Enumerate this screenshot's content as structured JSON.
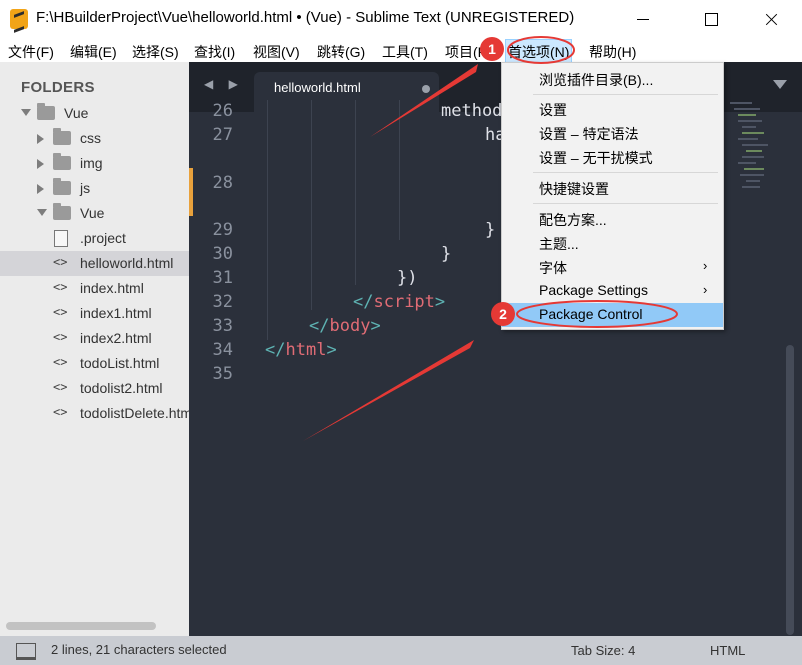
{
  "window": {
    "title": "F:\\HBuilderProject\\Vue\\helloworld.html • (Vue) - Sublime Text (UNREGISTERED)"
  },
  "menubar": {
    "items": [
      {
        "label": "文件(F)"
      },
      {
        "label": "编辑(E)"
      },
      {
        "label": "选择(S)"
      },
      {
        "label": "查找(I)"
      },
      {
        "label": "视图(V)"
      },
      {
        "label": "跳转(G)"
      },
      {
        "label": "工具(T)"
      },
      {
        "label": "项目(P)"
      },
      {
        "label": "首选项(N)"
      },
      {
        "label": "帮助(H)"
      }
    ]
  },
  "sidebar": {
    "header": "FOLDERS",
    "tree": [
      {
        "label": "Vue",
        "kind": "folder",
        "expanded": true
      },
      {
        "label": "css",
        "kind": "folder",
        "expanded": false
      },
      {
        "label": "img",
        "kind": "folder",
        "expanded": false
      },
      {
        "label": "js",
        "kind": "folder",
        "expanded": false
      },
      {
        "label": "Vue",
        "kind": "folder",
        "expanded": true
      },
      {
        "label": ".project",
        "kind": "file"
      },
      {
        "label": "helloworld.html",
        "kind": "code",
        "selected": true
      },
      {
        "label": "index.html",
        "kind": "code"
      },
      {
        "label": "index1.html",
        "kind": "code"
      },
      {
        "label": "index2.html",
        "kind": "code"
      },
      {
        "label": "todoList.html",
        "kind": "code"
      },
      {
        "label": "todolist2.html",
        "kind": "code"
      },
      {
        "label": "todolistDelete.html",
        "kind": "code"
      }
    ]
  },
  "tabs": {
    "nav": "◀ ▶",
    "active": {
      "label": "helloworld.html",
      "dirty": true
    }
  },
  "editor": {
    "line_numbers": [
      "26",
      "27",
      "28",
      "29",
      "30",
      "31",
      "32",
      "33",
      "34",
      "35"
    ],
    "code": {
      "l26": "method",
      "l27": "ha",
      "l29": "}",
      "l30": "}",
      "l31": "})",
      "l32_open": "</",
      "l32_tag": "script",
      "l32_close": ">",
      "l33_open": "</",
      "l33_tag": "body",
      "l33_close": ">",
      "l34_open": "</",
      "l34_tag": "html",
      "l34_close": ">"
    }
  },
  "preferences_menu": {
    "items": [
      {
        "label": "浏览插件目录(B)...",
        "submenu": false
      },
      {
        "label": "设置",
        "submenu": false
      },
      {
        "label": "设置 – 特定语法",
        "submenu": false
      },
      {
        "label": "设置 – 无干扰模式",
        "submenu": false
      },
      {
        "label": "快捷键设置",
        "submenu": false
      },
      {
        "label": "配色方案...",
        "submenu": false
      },
      {
        "label": "主题...",
        "submenu": false
      },
      {
        "label": "字体",
        "submenu": true
      },
      {
        "label": "Package Settings",
        "submenu": true
      },
      {
        "label": "Package Control",
        "submenu": false,
        "highlighted": true
      }
    ],
    "submenu_glyph": "›"
  },
  "annotations": {
    "badge1": "1",
    "badge2": "2"
  },
  "statusbar": {
    "selection": "2 lines, 21 characters selected",
    "tab_size": "Tab Size: 4",
    "syntax": "HTML"
  },
  "colors": {
    "editor_bg": "#2b303b",
    "tag": "#e06c75",
    "bracket": "#5eb3b3",
    "annotation_red": "#e53935",
    "menu_highlight": "#91c9f7"
  }
}
